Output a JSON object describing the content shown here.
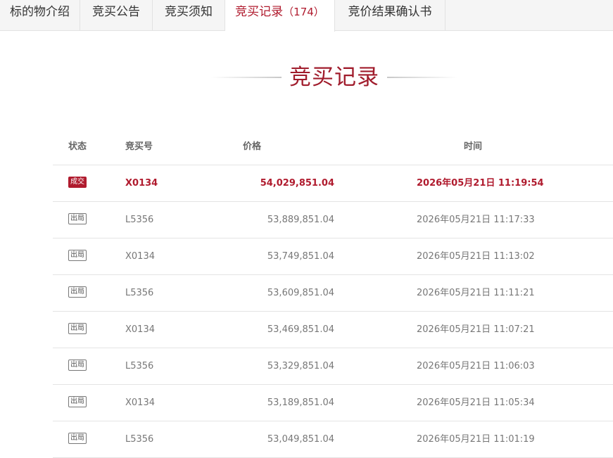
{
  "tabs": [
    {
      "label": "标的物介绍"
    },
    {
      "label": "竞买公告"
    },
    {
      "label": "竞买须知"
    },
    {
      "label": "竞买记录",
      "count": "（174）"
    },
    {
      "label": "竞价结果确认书"
    }
  ],
  "heading": "竞买记录",
  "table": {
    "headers": {
      "status": "状态",
      "bid_no": "竞买号",
      "price": "价格",
      "time": "时间"
    },
    "rows": [
      {
        "status": "成交",
        "bid_no": "X0134",
        "price": "54,029,851.04",
        "time": "2026年05月21日 11:19:54"
      },
      {
        "status": "出局",
        "bid_no": "L5356",
        "price": "53,889,851.04",
        "time": "2026年05月21日 11:17:33"
      },
      {
        "status": "出局",
        "bid_no": "X0134",
        "price": "53,749,851.04",
        "time": "2026年05月21日 11:13:02"
      },
      {
        "status": "出局",
        "bid_no": "L5356",
        "price": "53,609,851.04",
        "time": "2026年05月21日 11:11:21"
      },
      {
        "status": "出局",
        "bid_no": "X0134",
        "price": "53,469,851.04",
        "time": "2026年05月21日 11:07:21"
      },
      {
        "status": "出局",
        "bid_no": "L5356",
        "price": "53,329,851.04",
        "time": "2026年05月21日 11:06:03"
      },
      {
        "status": "出局",
        "bid_no": "X0134",
        "price": "53,189,851.04",
        "time": "2026年05月21日 11:05:34"
      },
      {
        "status": "出局",
        "bid_no": "L5356",
        "price": "53,049,851.04",
        "time": "2026年05月21日 11:01:19"
      }
    ]
  },
  "colors": {
    "accent": "#b01b2e",
    "heading": "#a01c2c",
    "muted": "#777777"
  }
}
